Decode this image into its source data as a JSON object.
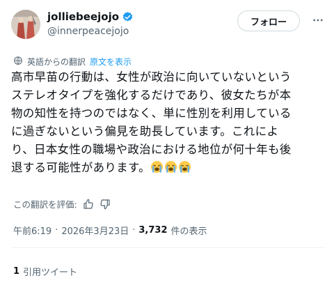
{
  "author": {
    "display_name": "jolliebeejojo",
    "handle": "@innerpeacejojo",
    "verified": true
  },
  "actions": {
    "follow_label": "フォロー"
  },
  "translation": {
    "notice": "英語からの翻訳",
    "show_original": "原文を表示",
    "rate_label": "この翻訳を評価:"
  },
  "tweet": {
    "text_lines": [
      "高市早苗の行動は、女性が政治に向いていないという",
      "ステレオタイプを強化するだけであり、彼女たちが本",
      "物の知性を持つのではなく、単に性別を利用している",
      "に過ぎないという偏見を助長しています。これによ",
      "り、日本女性の職場や政治における地位が何十年も後",
      "退する可能性があります。"
    ],
    "emojis": [
      "loudly-crying-face",
      "loudly-crying-face",
      "loudly-crying-face"
    ]
  },
  "meta": {
    "time": "午前6:19",
    "separator": "·",
    "date": "2026年3月23日",
    "views_count": "3,732",
    "views_label": "件の表示"
  },
  "engagement": {
    "quote_count": "1",
    "quote_label": "引用ツイート"
  },
  "colors": {
    "text": "#0f1419",
    "secondary": "#536471",
    "accent": "#1d9bf0",
    "border": "#cfd9de"
  }
}
